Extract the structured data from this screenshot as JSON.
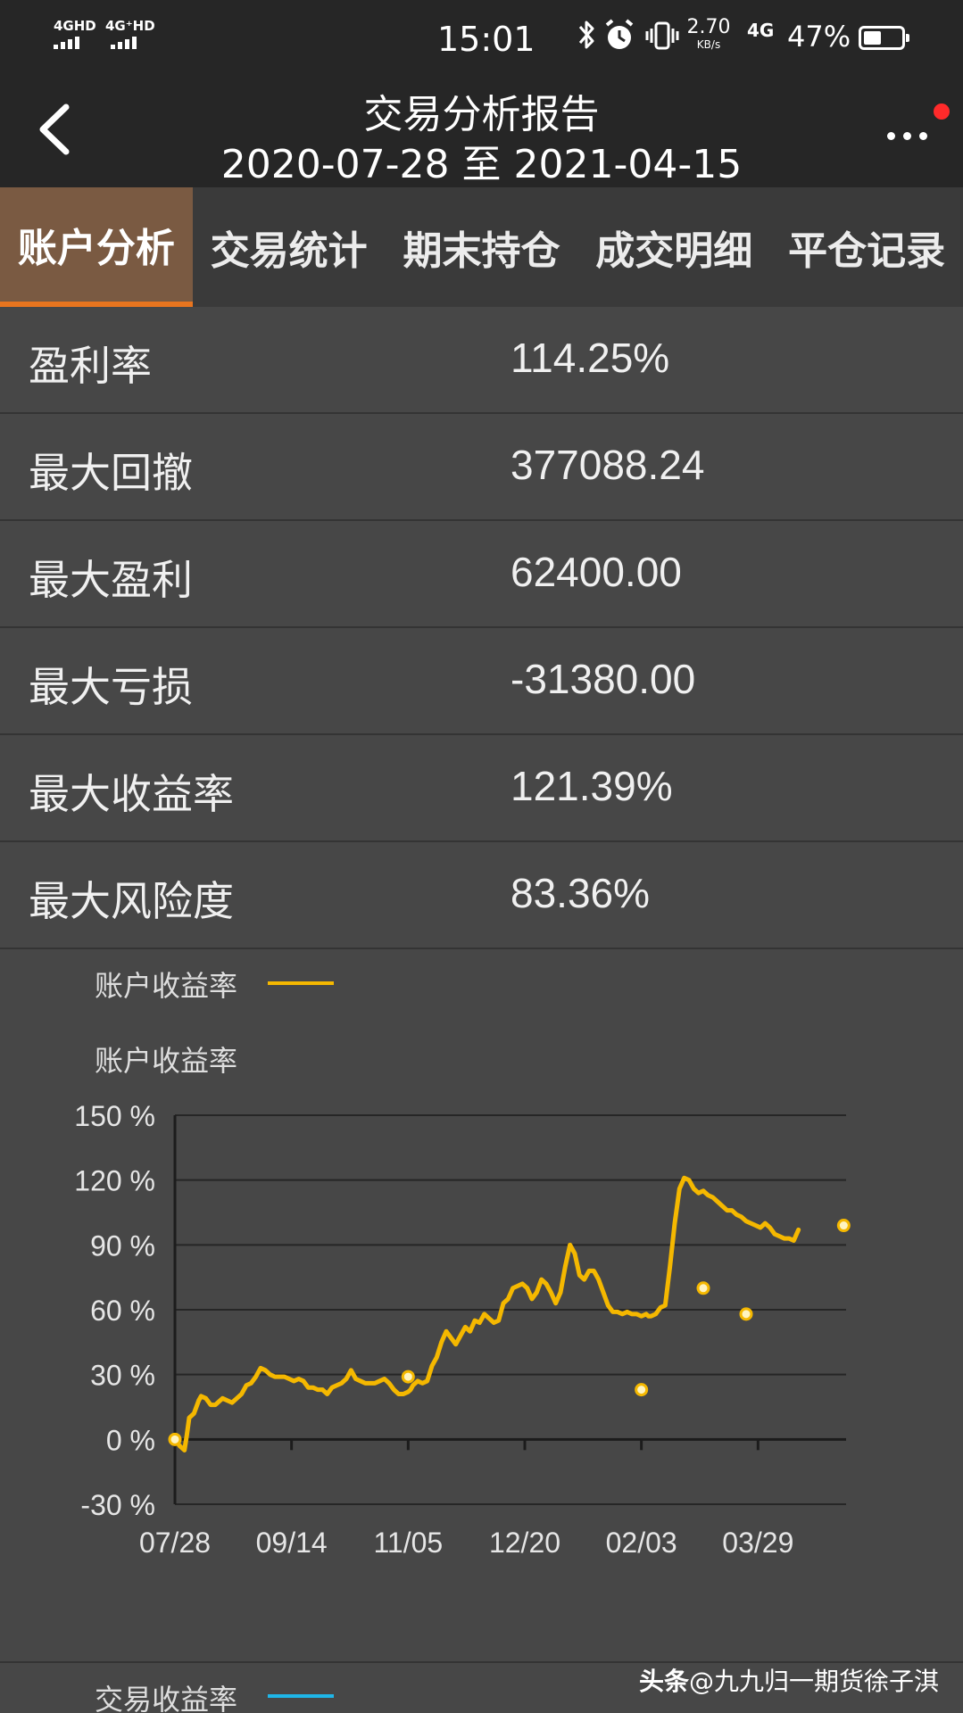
{
  "status_bar": {
    "net1": "4GHD",
    "net2": "4G⁺HD",
    "time": "15:01",
    "speed_value": "2.70",
    "speed_unit": "KB/s",
    "net3": "4G",
    "battery_percent": "47%",
    "battery_level": 0.47,
    "icons": [
      "bluetooth-icon",
      "alarm-icon",
      "vibrate-icon",
      "battery-icon"
    ]
  },
  "header": {
    "title": "交易分析报告",
    "date_range": "2020-07-28 至 2021-04-15",
    "back_icon": "chevron-left-icon",
    "more_icon": "more-dots-icon",
    "badge_color": "#ff2a2a"
  },
  "tabs": [
    {
      "label": "账户分析",
      "active": true
    },
    {
      "label": "交易统计",
      "active": false
    },
    {
      "label": "期末持仓",
      "active": false
    },
    {
      "label": "成交明细",
      "active": false
    },
    {
      "label": "平仓记录",
      "active": false
    }
  ],
  "stats": [
    {
      "label": "盈利率",
      "value": "114.25%"
    },
    {
      "label": "最大回撤",
      "value": "377088.24"
    },
    {
      "label": "最大盈利",
      "value": "62400.00"
    },
    {
      "label": "最大亏损",
      "value": "-31380.00"
    },
    {
      "label": "最大收益率",
      "value": "121.39%"
    },
    {
      "label": "最大风险度",
      "value": "83.36%"
    }
  ],
  "colors": {
    "accent_tab": "#e8751f",
    "series_line": "#f5b800",
    "series2_line": "#1fb6e8"
  },
  "chart_data": {
    "type": "line",
    "title": "账户收益率",
    "legend": [
      {
        "name": "账户收益率",
        "color": "#f5b800"
      }
    ],
    "legend_placement": "top-left",
    "ylim": [
      -30,
      150
    ],
    "y_ticks": [
      150,
      120,
      90,
      60,
      30,
      0,
      -30
    ],
    "y_tick_labels": [
      "150 %",
      "120 %",
      "90 %",
      "60 %",
      "30 %",
      "0 %",
      "-30 %"
    ],
    "x_ticks": [
      "07/28",
      "09/14",
      "11/05",
      "12/20",
      "02/03",
      "03/29"
    ],
    "grid": true,
    "series": [
      {
        "name": "账户收益率",
        "x": [
          0,
          2,
          4,
          5,
          6,
          8,
          10,
          11,
          13,
          15,
          17,
          18,
          20,
          22,
          24,
          26,
          28,
          30,
          32,
          34,
          36,
          38,
          40,
          42,
          44,
          46,
          48,
          50,
          52,
          54,
          56,
          58,
          60,
          62,
          64,
          66,
          68,
          70,
          72,
          74,
          76,
          78,
          80,
          82,
          84,
          86,
          88,
          90,
          92,
          94,
          96,
          98,
          99,
          100,
          102,
          104,
          106,
          108,
          110,
          112,
          114,
          116,
          118,
          120,
          122,
          124,
          126,
          128,
          130,
          132,
          134,
          136,
          138,
          140,
          142,
          144,
          146,
          148,
          150,
          152,
          154,
          156,
          158,
          160,
          162,
          164,
          166,
          168,
          170,
          172,
          174,
          176,
          178,
          180,
          182,
          184,
          186,
          188,
          190,
          192,
          194,
          196,
          198,
          199,
          200,
          202,
          204,
          206,
          208,
          210,
          212,
          214,
          216,
          218,
          220,
          222,
          224,
          226,
          228,
          230,
          232,
          234,
          236,
          238,
          240,
          242,
          244,
          246,
          248,
          250,
          252,
          254,
          256,
          258,
          260,
          262
        ],
        "values": [
          0,
          -3,
          -5,
          2,
          10,
          12,
          18,
          20,
          19,
          16,
          16,
          17,
          19,
          18,
          17,
          19,
          21,
          25,
          26,
          29,
          33,
          32,
          30,
          29,
          29,
          29,
          28,
          27,
          28,
          27,
          24,
          24,
          23,
          23,
          21,
          24,
          25,
          26,
          28,
          32,
          28,
          27,
          26,
          26,
          26,
          27,
          28,
          26,
          23,
          21,
          21,
          22,
          23,
          25,
          27,
          26,
          27,
          34,
          38,
          45,
          50,
          47,
          44,
          48,
          52,
          50,
          55,
          54,
          58,
          56,
          54,
          55,
          63,
          65,
          70,
          71,
          72,
          70,
          65,
          68,
          74,
          72,
          68,
          63,
          68,
          80,
          90,
          86,
          76,
          74,
          78,
          78,
          74,
          68,
          62,
          59,
          59,
          58,
          59,
          58,
          58,
          57,
          58,
          57,
          57,
          58,
          61,
          62,
          80,
          100,
          116,
          121,
          120,
          116,
          114,
          115,
          113,
          112,
          110,
          108,
          106,
          106,
          104,
          103,
          101,
          100,
          99,
          98,
          100,
          98,
          95,
          94,
          93,
          93,
          92,
          97
        ],
        "markers_at_x": [
          0,
          98,
          196,
          222,
          240,
          281
        ]
      }
    ],
    "marker_values": [
      0,
      29,
      23,
      70,
      58,
      99
    ]
  },
  "second_legend": {
    "name": "交易收益率",
    "color": "#1fb6e8"
  },
  "watermark": {
    "brand": "头条",
    "author": "@九九归一期货徐子淇"
  }
}
